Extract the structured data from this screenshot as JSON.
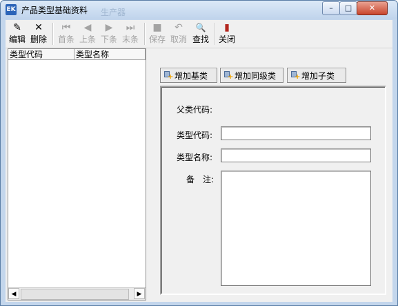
{
  "window": {
    "title": "产品类型基础资料",
    "ghost_text": "生产器",
    "buttons": {
      "minimize": "–",
      "maximize": "□",
      "close": "✕"
    }
  },
  "toolbar": {
    "items": [
      {
        "label": "编辑",
        "icon": "edit-icon",
        "glyph": "✎",
        "enabled": true
      },
      {
        "label": "删除",
        "icon": "delete-icon",
        "glyph": "✕",
        "enabled": true
      },
      {
        "label": "首条",
        "icon": "first-record-icon",
        "glyph": "⏮",
        "enabled": false
      },
      {
        "label": "上条",
        "icon": "previous-record-icon",
        "glyph": "◀",
        "enabled": false
      },
      {
        "label": "下条",
        "icon": "next-record-icon",
        "glyph": "▶",
        "enabled": false
      },
      {
        "label": "末条",
        "icon": "last-record-icon",
        "glyph": "⏭",
        "enabled": false
      },
      {
        "label": "保存",
        "icon": "save-icon",
        "glyph": "■",
        "enabled": false
      },
      {
        "label": "取消",
        "icon": "undo-icon",
        "glyph": "↶",
        "enabled": false
      },
      {
        "label": "查找",
        "icon": "find-icon",
        "glyph": "🔍",
        "enabled": true
      },
      {
        "label": "关闭",
        "icon": "exit-door-icon",
        "glyph": "▮",
        "enabled": true
      }
    ]
  },
  "tree": {
    "columns": [
      "类型代码",
      "类型名称"
    ],
    "rows": [],
    "scroll": {
      "left": "◀",
      "right": "▶"
    }
  },
  "panel": {
    "tabs": [
      {
        "label": "增加基类",
        "icon": "add-base-class-icon"
      },
      {
        "label": "增加同级类",
        "icon": "add-sibling-class-icon"
      },
      {
        "label": "增加子类",
        "icon": "add-child-class-icon"
      }
    ],
    "form": {
      "parent_code_label": "父类代码:",
      "parent_code_value": "",
      "type_code_label": "类型代码:",
      "type_code_value": "",
      "type_name_label": "类型名称:",
      "type_name_value": "",
      "remark_label": "备　注:",
      "remark_value": ""
    }
  }
}
